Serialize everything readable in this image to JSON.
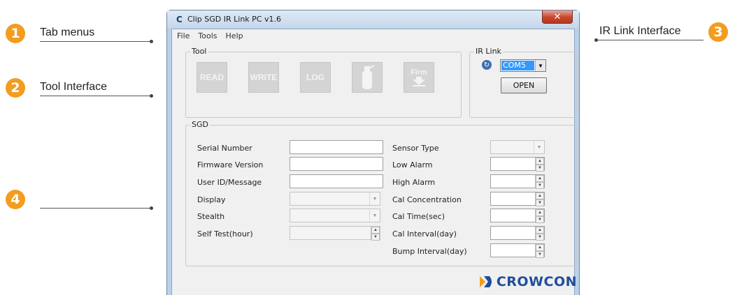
{
  "callouts": [
    {
      "number": "1",
      "label": "Tab menus"
    },
    {
      "number": "2",
      "label": "Tool Interface"
    },
    {
      "number": "3",
      "label": "IR Link Interface"
    },
    {
      "number": "4",
      "label": ""
    }
  ],
  "window": {
    "icon": "C",
    "title": "Clip SGD IR Link PC v1.6",
    "close_label": "✕"
  },
  "menu": [
    "File",
    "Tools",
    "Help"
  ],
  "tool_group": {
    "legend": "Tool",
    "buttons": [
      "READ",
      "WRITE",
      "LOG",
      "",
      "Firm"
    ]
  },
  "ir_link": {
    "legend": "IR Link",
    "port_value": "COM5",
    "open_label": "OPEN"
  },
  "sgd": {
    "legend": "SGD",
    "left_fields": [
      {
        "label": "Serial Number"
      },
      {
        "label": "Firmware Version"
      },
      {
        "label": "User ID/Message"
      },
      {
        "label": "Display"
      },
      {
        "label": "Stealth"
      },
      {
        "label": "Self Test(hour)"
      }
    ],
    "right_fields": [
      {
        "label": "Sensor Type"
      },
      {
        "label": "Low Alarm"
      },
      {
        "label": "High Alarm"
      },
      {
        "label": "Cal Concentration"
      },
      {
        "label": "Cal Time(sec)"
      },
      {
        "label": "Cal Interval(day)"
      },
      {
        "label": "Bump Interval(day)"
      }
    ]
  },
  "logo": {
    "text": "CROWCON",
    "color": "#1f4e9c",
    "accent": "#f39c1e"
  },
  "colors": {
    "badge": "#f39c1e",
    "selection": "#3399ff",
    "close": "#c8452c"
  }
}
